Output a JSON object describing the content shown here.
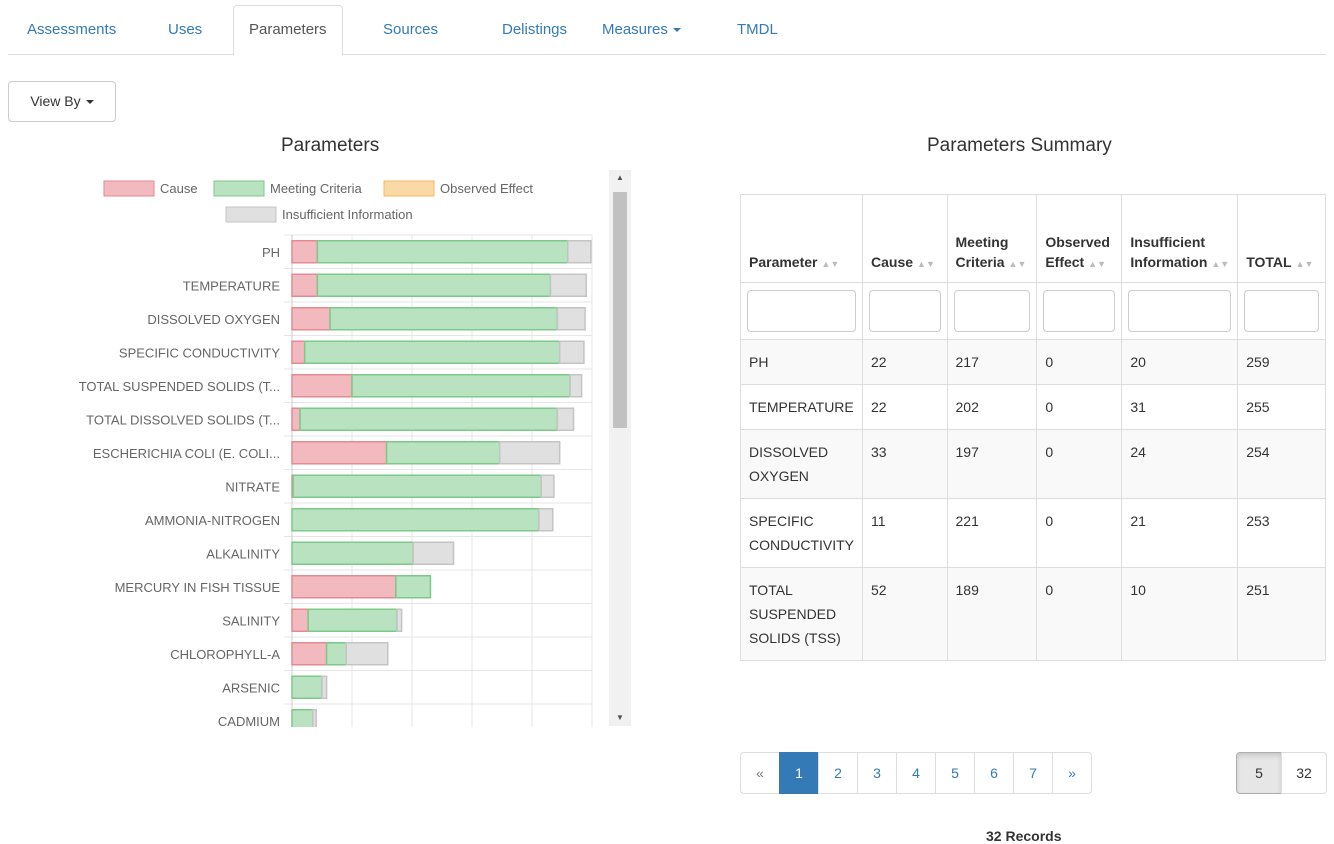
{
  "tabs": [
    {
      "label": "Assessments"
    },
    {
      "label": "Uses"
    },
    {
      "label": "Parameters"
    },
    {
      "label": "Sources"
    },
    {
      "label": "Delistings"
    },
    {
      "label": "Measures"
    },
    {
      "label": "TMDL"
    }
  ],
  "view_by": {
    "label": "View By"
  },
  "chart_title": "Parameters",
  "table_title": "Parameters Summary",
  "chart_data": {
    "type": "bar",
    "orientation": "horizontal",
    "stacked": true,
    "legend_position": "top",
    "grid": true,
    "xlim": [
      0,
      260
    ],
    "legend": [
      "Cause",
      "Meeting Criteria",
      "Observed Effect",
      "Insufficient Information"
    ],
    "categories": [
      "PH",
      "TEMPERATURE",
      "DISSOLVED OXYGEN",
      "SPECIFIC CONDUCTIVITY",
      "TOTAL SUSPENDED SOLIDS (T...",
      "TOTAL DISSOLVED SOLIDS (T...",
      "ESCHERICHIA COLI (E. COLI...",
      "NITRATE",
      "AMMONIA-NITROGEN",
      "ALKALINITY",
      "MERCURY IN FISH TISSUE",
      "SALINITY",
      "CHLOROPHYLL-A",
      "ARSENIC",
      "CADMIUM"
    ],
    "series": [
      {
        "name": "Cause",
        "color": "#f2b9bf",
        "edge": "#e58a93",
        "values": [
          22,
          22,
          33,
          11,
          52,
          7,
          82,
          1,
          0,
          0,
          90,
          14,
          30,
          0,
          0
        ]
      },
      {
        "name": "Meeting Criteria",
        "color": "#b9e3c0",
        "edge": "#7cc98a",
        "values": [
          217,
          202,
          197,
          221,
          189,
          223,
          98,
          215,
          214,
          105,
          30,
          77,
          17,
          26,
          18
        ]
      },
      {
        "name": "Observed Effect",
        "color": "#fbd9a6",
        "edge": "#f5b964",
        "values": [
          0,
          0,
          0,
          0,
          0,
          0,
          0,
          0,
          0,
          0,
          0,
          0,
          0,
          0,
          0
        ]
      },
      {
        "name": "Insufficient Information",
        "color": "#e0e0e0",
        "edge": "#c4c4c4",
        "values": [
          20,
          31,
          24,
          21,
          10,
          14,
          52,
          11,
          12,
          35,
          0,
          4,
          36,
          4,
          3
        ]
      }
    ]
  },
  "table": {
    "headers": [
      {
        "label": "Parameter"
      },
      {
        "label": "Cause"
      },
      {
        "label": "Meeting Criteria"
      },
      {
        "label": "Observed Effect"
      },
      {
        "label": "Insufficient Information"
      },
      {
        "label": "TOTAL"
      }
    ],
    "rows": [
      [
        "PH",
        "22",
        "217",
        "0",
        "20",
        "259"
      ],
      [
        "TEMPERATURE",
        "22",
        "202",
        "0",
        "31",
        "255"
      ],
      [
        "DISSOLVED OXYGEN",
        "33",
        "197",
        "0",
        "24",
        "254"
      ],
      [
        "SPECIFIC CONDUCTIVITY",
        "11",
        "221",
        "0",
        "21",
        "253"
      ],
      [
        "TOTAL SUSPENDED SOLIDS (TSS)",
        "52",
        "189",
        "0",
        "10",
        "251"
      ]
    ]
  },
  "pagination": {
    "prev": "«",
    "next": "»",
    "pages": [
      "1",
      "2",
      "3",
      "4",
      "5",
      "6",
      "7"
    ],
    "current": "1"
  },
  "page_size": {
    "options": [
      "5",
      "32"
    ],
    "selected": "5"
  },
  "records_label": "32 Records"
}
